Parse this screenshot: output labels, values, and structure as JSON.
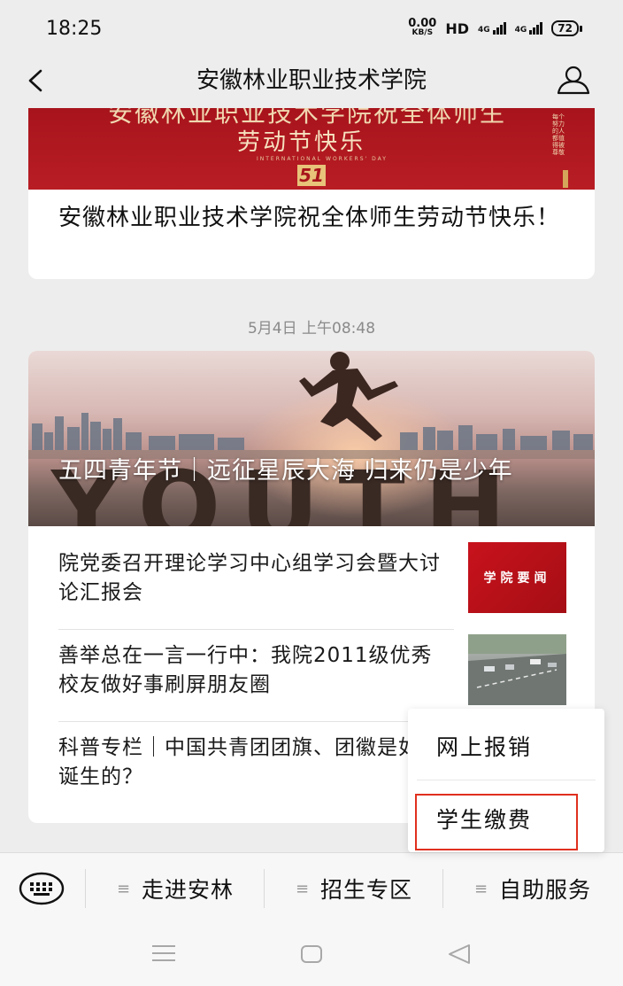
{
  "status": {
    "time": "18:25",
    "net_speed_value": "0.00",
    "net_speed_unit": "KB/S",
    "hd_label": "HD",
    "signal1": "4G",
    "signal2": "4G",
    "battery": "72"
  },
  "nav": {
    "title": "安徽林业职业技术学院",
    "back_icon": "chevron-left-icon",
    "profile_icon": "user-icon"
  },
  "article1": {
    "banner_line1": "安徽林业职业技术学院祝全体师生",
    "banner_line2": "劳动节快乐",
    "banner_sub": "INTERNATIONAL WORKERS' DAY",
    "banner_badge": "51",
    "banner_side": "每个努力的人都值得被尊敬",
    "title": "安徽林业职业技术学院祝全体师生劳动节快乐！"
  },
  "timestamp": "5月4日 上午08:48",
  "article2": {
    "hero_bg_text": "YOUTH",
    "hero_title": "五四青年节｜远征星辰大海 归来仍是少年",
    "items": [
      {
        "title": "院党委召开理论学习中心组学习会暨大讨论汇报会",
        "thumb_text": "学院要闻"
      },
      {
        "title": "善举总在一言一行中：我院2011级优秀校友做好事刷屏朋友圈"
      },
      {
        "title": "科普专栏｜中国共青团团旗、团徽是如何诞生的？"
      }
    ]
  },
  "menu": {
    "keyboard_icon": "keyboard-icon",
    "items": [
      {
        "label": "走进安林",
        "icon": "≡"
      },
      {
        "label": "招生专区",
        "icon": "≡"
      },
      {
        "label": "自助服务",
        "icon": "≡"
      }
    ],
    "submenu": [
      "网上报销",
      "学生缴费"
    ]
  },
  "colors": {
    "accent_red": "#b81d24",
    "highlight": "#e0301e",
    "background": "#ededed"
  }
}
